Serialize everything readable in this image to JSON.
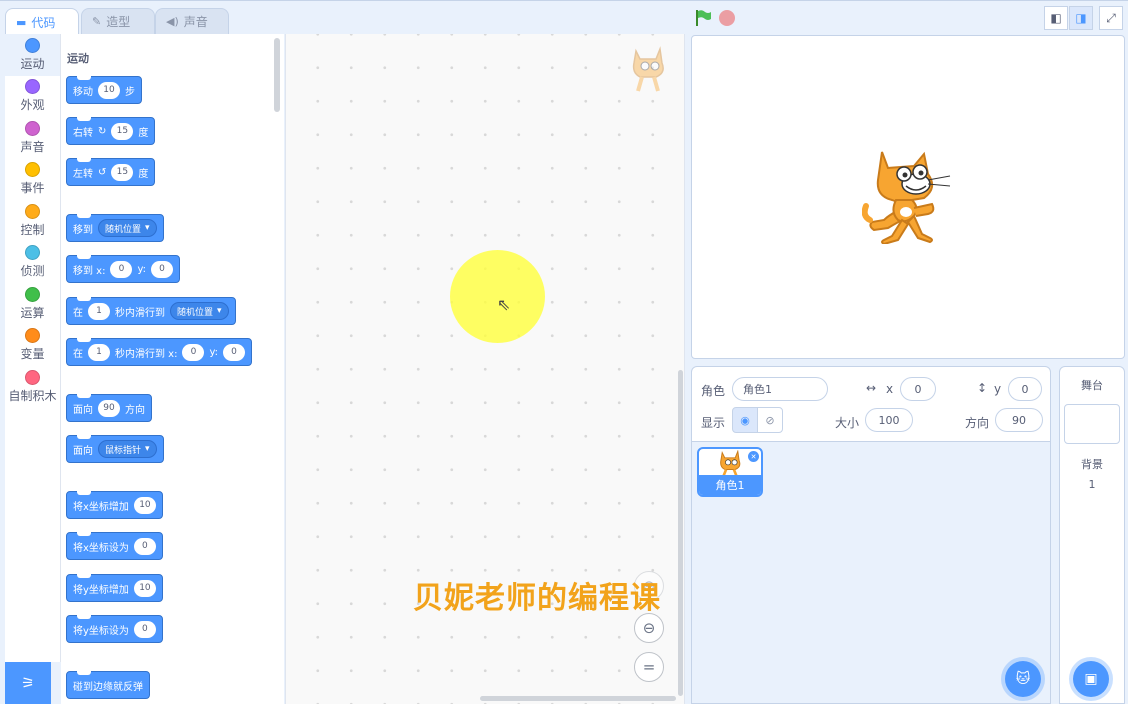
{
  "tabs": [
    {
      "label": "代码",
      "icon": "code-icon"
    },
    {
      "label": "造型",
      "icon": "brush-icon"
    },
    {
      "label": "声音",
      "icon": "speaker-icon"
    }
  ],
  "categories": [
    {
      "label": "运动",
      "color": "#4c97ff"
    },
    {
      "label": "外观",
      "color": "#9966ff"
    },
    {
      "label": "声音",
      "color": "#cf63cf"
    },
    {
      "label": "事件",
      "color": "#ffbf00"
    },
    {
      "label": "控制",
      "color": "#ffab19"
    },
    {
      "label": "侦测",
      "color": "#4cbfe6"
    },
    {
      "label": "运算",
      "color": "#40bf4a"
    },
    {
      "label": "变量",
      "color": "#ff8c1a"
    },
    {
      "label": "自制积木",
      "color": "#ff6680"
    }
  ],
  "palette": {
    "title": "运动",
    "move": {
      "a": "移动",
      "v": "10",
      "b": "步"
    },
    "turn_right": {
      "a": "右转",
      "v": "15",
      "b": "度"
    },
    "turn_left": {
      "a": "左转",
      "v": "15",
      "b": "度"
    },
    "goto": {
      "a": "移到",
      "d": "随机位置"
    },
    "goto_xy": {
      "a": "移到 x:",
      "x": "0",
      "b": "y:",
      "y": "0"
    },
    "glide": {
      "a": "在",
      "v": "1",
      "b": "秒内滑行到",
      "d": "随机位置"
    },
    "glide_xy": {
      "a": "在",
      "v": "1",
      "b": "秒内滑行到 x:",
      "x": "0",
      "c": "y:",
      "y": "0"
    },
    "point_dir": {
      "a": "面向",
      "v": "90",
      "b": "方向"
    },
    "point_towards": {
      "a": "面向",
      "d": "鼠标指针"
    },
    "change_x": {
      "a": "将x坐标增加",
      "v": "10"
    },
    "set_x": {
      "a": "将x坐标设为",
      "v": "0"
    },
    "change_y": {
      "a": "将y坐标增加",
      "v": "10"
    },
    "set_y": {
      "a": "将y坐标设为",
      "v": "0"
    },
    "bounce": {
      "a": "碰到边缘就反弹"
    }
  },
  "watermark": "贝妮老师的编程课",
  "sprite": {
    "label": "角色",
    "name": "角色1",
    "x_label": "x",
    "x": "0",
    "y_label": "y",
    "y": "0",
    "show_label": "显示",
    "size_label": "大小",
    "size": "100",
    "dir_label": "方向",
    "dir": "90"
  },
  "sprite_card": {
    "name": "角色1"
  },
  "stage_pane": {
    "title": "舞台",
    "backdrop_label": "背景",
    "backdrop_count": "1"
  }
}
